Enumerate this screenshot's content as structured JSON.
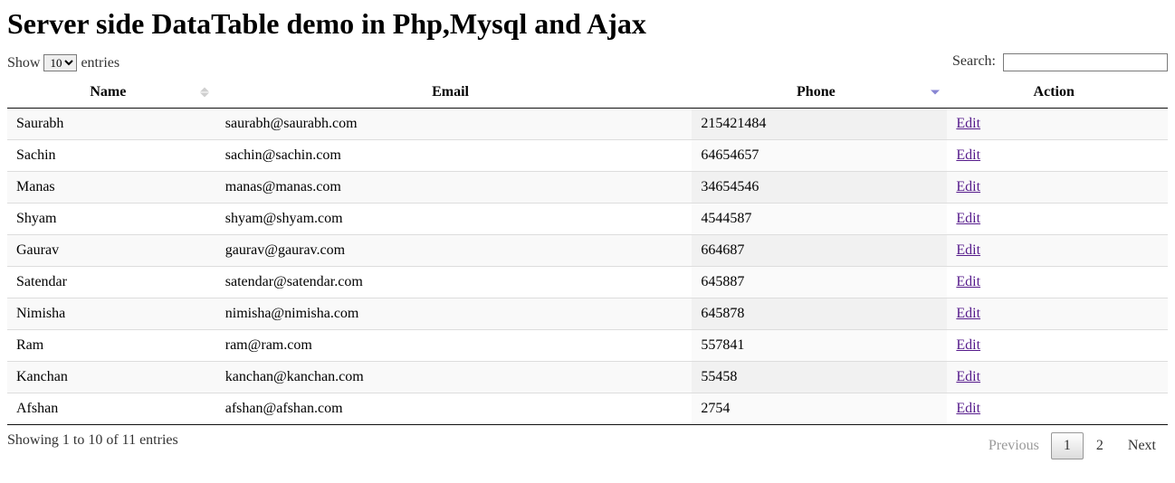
{
  "title": "Server side DataTable demo in Php,Mysql and Ajax",
  "length_control": {
    "prefix": "Show",
    "suffix": "entries",
    "value": "10"
  },
  "search": {
    "label": "Search:",
    "value": ""
  },
  "columns": {
    "name": "Name",
    "email": "Email",
    "phone": "Phone",
    "action": "Action"
  },
  "rows": [
    {
      "name": "Saurabh",
      "email": "saurabh@saurabh.com",
      "phone": "215421484",
      "action": "Edit"
    },
    {
      "name": "Sachin",
      "email": "sachin@sachin.com",
      "phone": "64654657",
      "action": "Edit"
    },
    {
      "name": "Manas",
      "email": "manas@manas.com",
      "phone": "34654546",
      "action": "Edit"
    },
    {
      "name": "Shyam",
      "email": "shyam@shyam.com",
      "phone": "4544587",
      "action": "Edit"
    },
    {
      "name": "Gaurav",
      "email": "gaurav@gaurav.com",
      "phone": "664687",
      "action": "Edit"
    },
    {
      "name": "Satendar",
      "email": "satendar@satendar.com",
      "phone": "645887",
      "action": "Edit"
    },
    {
      "name": "Nimisha",
      "email": "nimisha@nimisha.com",
      "phone": "645878",
      "action": "Edit"
    },
    {
      "name": "Ram",
      "email": "ram@ram.com",
      "phone": "557841",
      "action": "Edit"
    },
    {
      "name": "Kanchan",
      "email": "kanchan@kanchan.com",
      "phone": "55458",
      "action": "Edit"
    },
    {
      "name": "Afshan",
      "email": "afshan@afshan.com",
      "phone": "2754",
      "action": "Edit"
    }
  ],
  "info": "Showing 1 to 10 of 11 entries",
  "pagination": {
    "previous": "Previous",
    "next": "Next",
    "pages": [
      "1",
      "2"
    ],
    "current": "1"
  }
}
